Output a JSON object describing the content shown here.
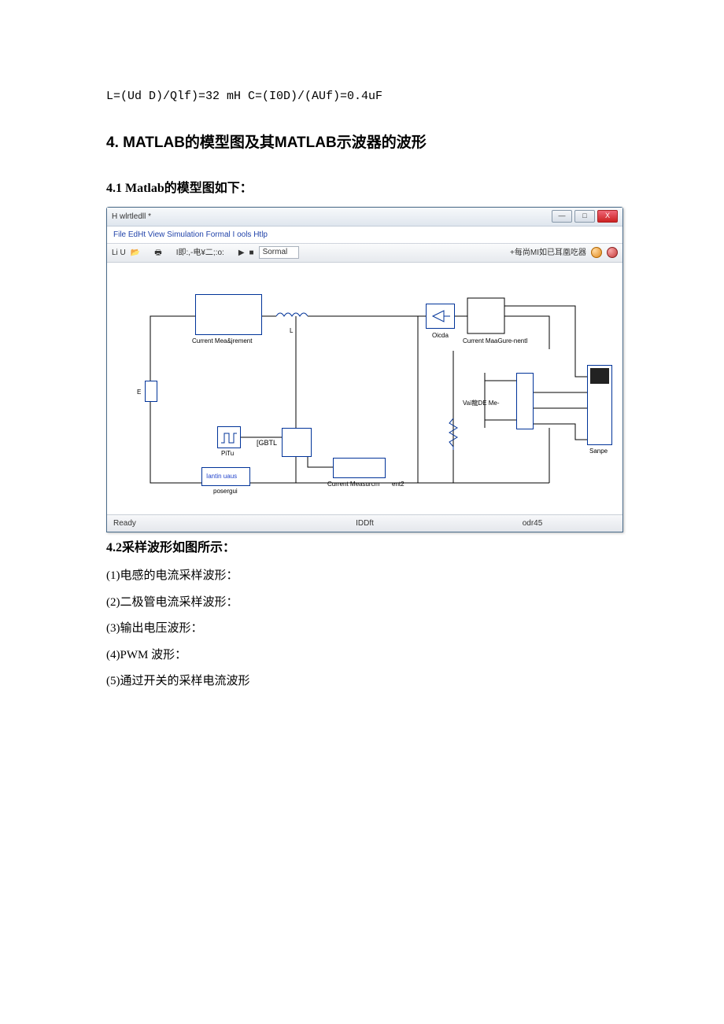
{
  "formula": "L=(Ud D)/Qlf)=32 mH C=(I0D)/(AUf)=0.4uF",
  "heading_main": "4. MATLAB的模型图及其MATLAB示波器的波形",
  "heading_4_1": "4.1 Matlab的模型图如下：",
  "simwin": {
    "title": "H wlrtledll *",
    "menubar": "File EdHt View Simulation Formal I ools Htlp",
    "toolbar_left": "Li U",
    "toolbar_mid": "I即:,-电¥二;:o:",
    "toolbar_mode": "Sormal",
    "toolbar_right": "+每尚MI如已耳凰吃器",
    "blocks": {
      "cm_label": "Current Mea&jrement",
      "L_label": "L",
      "diode_label": "Oicda",
      "cm1_label": "Current MaaGure-nentl",
      "pulse_label": "PiTu",
      "igbt_label": "[GBTL",
      "cm2_label": "Current Measurcm",
      "cm2_label2": "ent2",
      "vm_label": "Vaï龍DE Me-",
      "scope_label": "Sanpe",
      "cont_label": "Iantin uaus",
      "pg_label": "posergui",
      "E_label": "E"
    },
    "status": {
      "left": "Ready",
      "mid": "IDDft",
      "right": "odr45"
    },
    "winbtns": {
      "min": "—",
      "max": "□",
      "close": "X"
    }
  },
  "heading_4_2": "4.2采样波形如图所示：",
  "items": [
    "(1)电感的电流采样波形：",
    "(2)二极管电流采样波形：",
    "(3)输出电压波形：",
    "(4)PWM 波形：",
    "(5)通过开关的采样电流波形"
  ]
}
